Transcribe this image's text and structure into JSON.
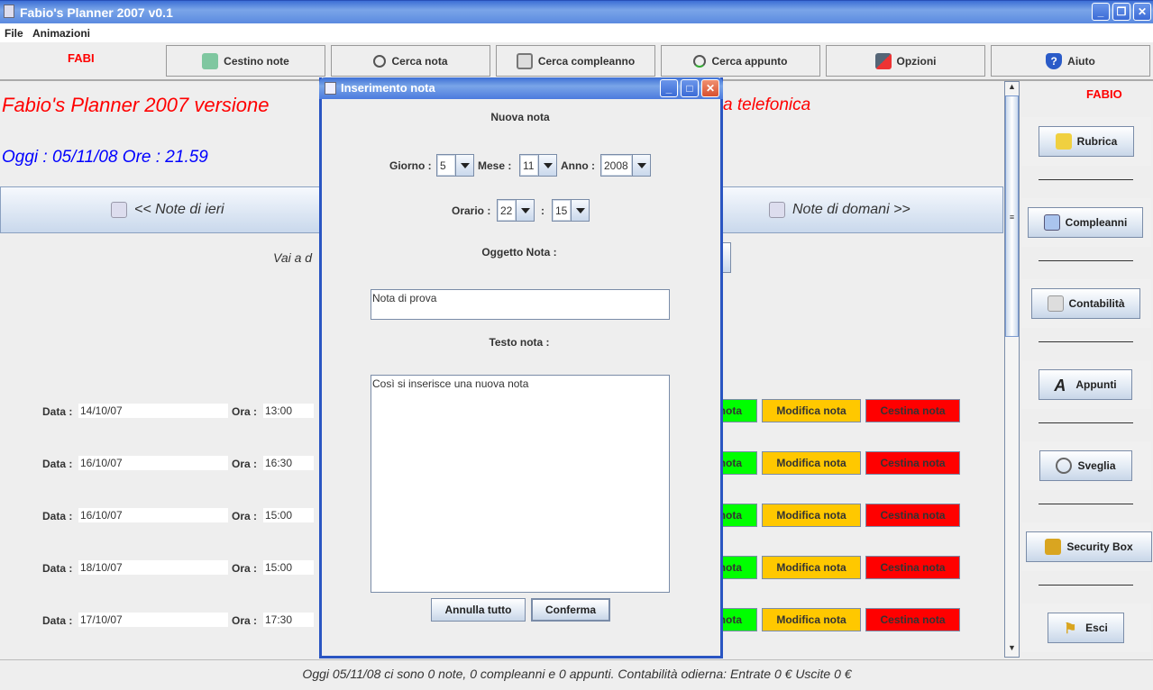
{
  "window": {
    "title": "Fabio's Planner 2007  v0.1"
  },
  "menu": [
    "File",
    "Animazioni"
  ],
  "toolbar": {
    "user": "FABI",
    "buttons": [
      {
        "label": "Cestino note",
        "icon": "recycle-bin-icon"
      },
      {
        "label": "Cerca nota",
        "icon": "magnifier-icon"
      },
      {
        "label": "Cerca compleanno",
        "icon": "magnifier-icon"
      },
      {
        "label": "Cerca appunto",
        "icon": "magnifier-check-icon"
      },
      {
        "label": "Opzioni",
        "icon": "tools-icon"
      },
      {
        "label": "Aiuto",
        "icon": "help-shield-icon"
      }
    ]
  },
  "main": {
    "heading_left": "Fabio's Planner 2007  versione",
    "heading_right": "a telefonica",
    "today": "Oggi : 05/11/08  Ore : 21.59",
    "prev_label": "<< Note di ieri",
    "next_label": "Note di domani >>",
    "goto_label": "Vai a d",
    "data_label": "Data :",
    "ora_label": "Ora :",
    "view_label": "nota",
    "edit_label": "Modifica nota",
    "trash_label": "Cestina nota",
    "rows": [
      {
        "date": "14/10/07",
        "time": "13:00"
      },
      {
        "date": "16/10/07",
        "time": "16:30"
      },
      {
        "date": "16/10/07",
        "time": "15:00"
      },
      {
        "date": "18/10/07",
        "time": "15:00"
      },
      {
        "date": "17/10/07",
        "time": "17:30"
      }
    ]
  },
  "sidebar": {
    "user": "FABIO",
    "buttons": [
      {
        "label": "Rubrica",
        "icon": "address-book-icon"
      },
      {
        "label": "Compleanni",
        "icon": "calendar-icon"
      },
      {
        "label": "Contabilità",
        "icon": "calculator-icon"
      },
      {
        "label": "Appunti",
        "icon": "font-a-icon"
      },
      {
        "label": "Sveglia",
        "icon": "alarm-clock-icon"
      },
      {
        "label": "Security Box",
        "icon": "padlock-icon"
      },
      {
        "label": "Esci",
        "icon": "exit-runner-icon"
      }
    ]
  },
  "status": "Oggi 05/11/08 ci sono 0 note, 0 compleanni e 0 appunti. Contabilità odierna: Entrate 0 € Uscite 0 €",
  "dialog": {
    "title": "Inserimento nota",
    "heading": "Nuova nota",
    "giorno_label": "Giorno :",
    "giorno": "5",
    "mese_label": "Mese :",
    "mese": "11",
    "anno_label": "Anno :",
    "anno": "2008",
    "orario_label": "Orario :",
    "ore": "22",
    "colon": ":",
    "minuti": "15",
    "oggetto_label": "Oggetto Nota :",
    "oggetto": "Nota di prova",
    "testo_label": "Testo nota :",
    "testo": "Così si inserisce una nuova nota",
    "cancel": "Annulla tutto",
    "confirm": "Conferma"
  },
  "colors": {
    "view": "#00ff00",
    "edit": "#ffc800",
    "trash": "#ff0000",
    "heading": "#ff0000",
    "today": "#0000ff"
  }
}
